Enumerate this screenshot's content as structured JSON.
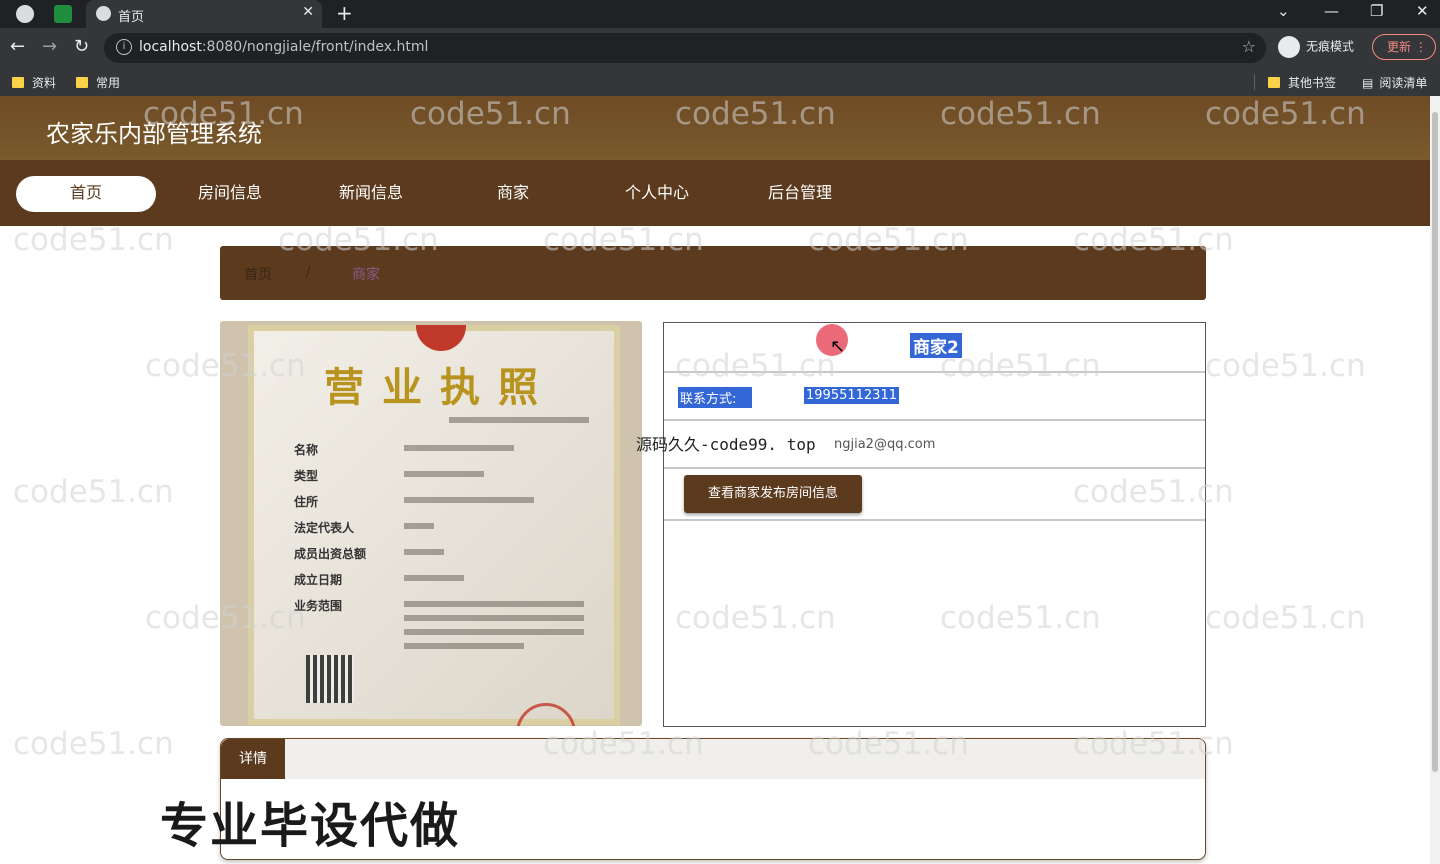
{
  "browser": {
    "tab_title": "首页",
    "url_host": "localhost",
    "url_rest": ":8080/nongjiale/front/index.html",
    "incognito_label": "无痕模式",
    "update_label": "更新",
    "bookmarks": [
      "资料",
      "常用"
    ],
    "bookmarks_right": [
      "其他书签",
      "阅读清单"
    ]
  },
  "site": {
    "title": "农家乐内部管理系统",
    "nav": [
      "首页",
      "房间信息",
      "新闻信息",
      "商家",
      "个人中心",
      "后台管理"
    ],
    "active_nav": "首页"
  },
  "breadcrumb": {
    "home": "首页",
    "separator": "/",
    "current": "商家"
  },
  "license": {
    "title": "营业执照",
    "fields": [
      "名称",
      "类型",
      "住所",
      "法定代表人",
      "成员出资总额",
      "成立日期",
      "业务范围"
    ]
  },
  "merchant": {
    "name": "商家2",
    "contact_label": "联系方式:",
    "contact_value": "19955112311",
    "email_value": "ngjia2@qq.com",
    "view_button": "查看商家发布房间信息"
  },
  "detail": {
    "tab_label": "详情"
  },
  "overlays": {
    "source_text": "源码久久-code99. top",
    "promo_text": "专业毕设代做"
  },
  "watermark_text": "code51.cn",
  "colors": {
    "primary": "#5c3a1e",
    "header": "#6e4b24",
    "selection": "#3367d6"
  }
}
